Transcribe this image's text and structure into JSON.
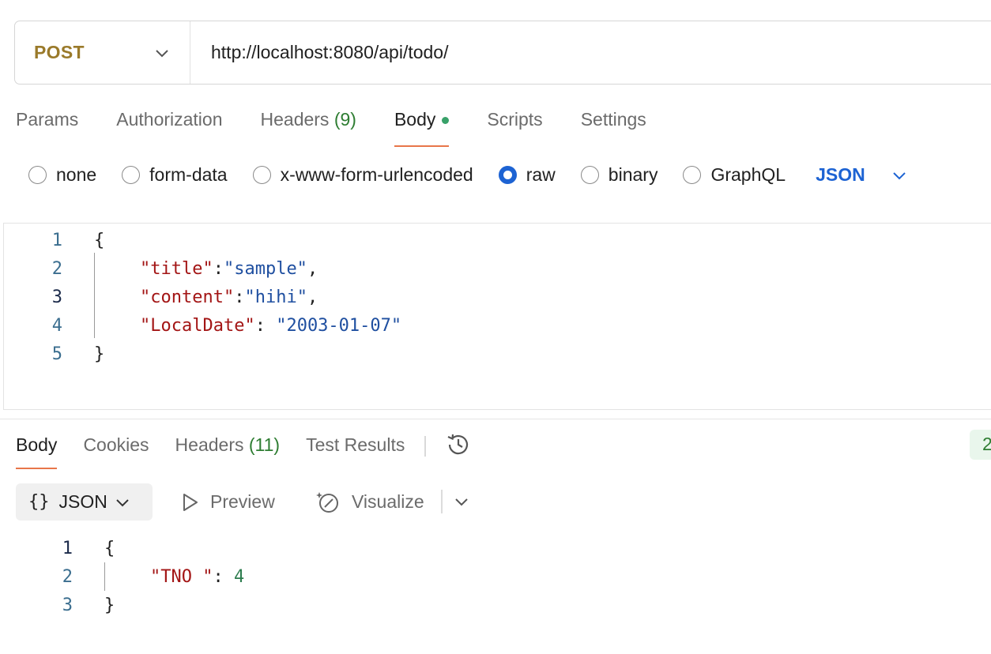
{
  "request": {
    "method": "POST",
    "url": "http://localhost:8080/api/todo/",
    "tabs": [
      {
        "label": "Params",
        "count": ""
      },
      {
        "label": "Authorization",
        "count": ""
      },
      {
        "label": "Headers",
        "count": "(9)"
      },
      {
        "label": "Body",
        "count": ""
      },
      {
        "label": "Scripts",
        "count": ""
      },
      {
        "label": "Settings",
        "count": ""
      }
    ],
    "body_types": [
      "none",
      "form-data",
      "x-www-form-urlencoded",
      "raw",
      "binary",
      "GraphQL"
    ],
    "selected_body_type": "raw",
    "raw_format": "JSON",
    "line_numbers": [
      "1",
      "2",
      "3",
      "4",
      "5"
    ],
    "code": {
      "open": "{",
      "l2_key": "\"title\"",
      "l2_colon": ":",
      "l2_val": "\"sample\"",
      "l2_end": ",",
      "l3_key": "\"content\"",
      "l3_colon": ":",
      "l3_val": "\"hihi\"",
      "l3_end": ",",
      "l4_key": "\"LocalDate\"",
      "l4_colon": ": ",
      "l4_val": "\"2003-01-07\"",
      "close": "}"
    }
  },
  "response": {
    "tabs": [
      {
        "label": "Body",
        "count": ""
      },
      {
        "label": "Cookies",
        "count": ""
      },
      {
        "label": "Headers",
        "count": "(11)"
      },
      {
        "label": "Test Results",
        "count": ""
      }
    ],
    "status_partial": "2",
    "format": {
      "braces": "{}",
      "label": "JSON"
    },
    "preview_label": "Preview",
    "visualize_label": "Visualize",
    "line_numbers": [
      "1",
      "2",
      "3"
    ],
    "code": {
      "open": "{",
      "l2_key": "\"TNO \"",
      "l2_colon": ": ",
      "l2_val": "4",
      "close": "}"
    }
  },
  "colors": {
    "method": "#9a7a2a",
    "accent_tab": "#e8764a",
    "radio_selected": "#1d63d3",
    "json_key": "#a31515",
    "json_string": "#1f4fa0",
    "json_number": "#2e7d4f",
    "count_green": "#2e7d32"
  },
  "icons": {
    "method_dropdown": "chevron-down-icon",
    "history": "history-icon",
    "preview": "play-icon",
    "visualize": "visualize-icon"
  }
}
